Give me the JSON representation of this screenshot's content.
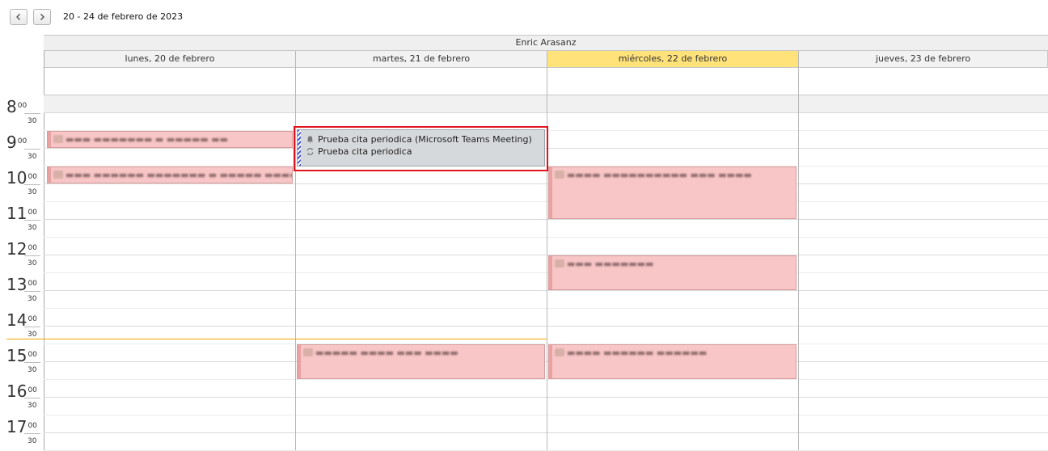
{
  "toolbar": {
    "range_label": "20 - 24 de febrero de 2023",
    "prev_icon": "chevron-left-icon",
    "next_icon": "chevron-right-icon"
  },
  "owner": "Enric Arasanz",
  "days": [
    {
      "label": "lunes, 20 de febrero",
      "today": false
    },
    {
      "label": "martes, 21 de febrero",
      "today": false
    },
    {
      "label": "miércoles, 22 de febrero",
      "today": true
    },
    {
      "label": "jueves, 23 de febrero",
      "today": false
    }
  ],
  "time_slots": {
    "hours": [
      "8",
      "9",
      "10",
      "11",
      "12",
      "13",
      "14",
      "15",
      "16",
      "17"
    ],
    "minutes_full": "00",
    "minutes_half": "30"
  },
  "selected_event": {
    "title": "Prueba cita periodica (Microsoft Teams Meeting)",
    "subtitle": "Prueba cita periodica",
    "reminder_icon": "bell-icon",
    "recurrence_icon": "recurrence-icon"
  },
  "colors": {
    "today_header": "#ffe27a",
    "event_pink": "#f8c6c6",
    "event_gray": "#d6d9dc",
    "highlight_red": "#e0141a",
    "now_line": "#f0a400"
  }
}
